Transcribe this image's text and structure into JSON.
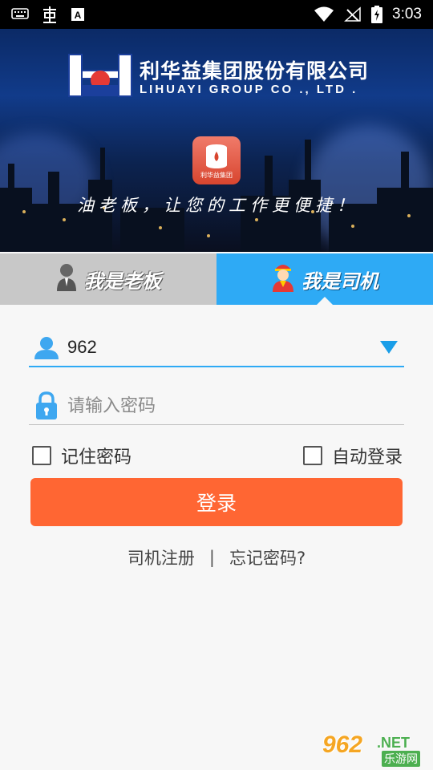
{
  "status_bar": {
    "time": "3:03",
    "icons": [
      "keyboard-icon",
      "bug-icon",
      "a-icon",
      "wifi-icon",
      "no-signal-icon",
      "battery-charging-icon"
    ]
  },
  "header": {
    "logo_cn": "利华益集团股份有限公司",
    "logo_en": "LIHUAYI GROUP CO ., LTD .",
    "app_icon_label": "利华益集团",
    "slogan": "油老板，让您的工作更便捷！"
  },
  "tabs": [
    {
      "label": "我是老板",
      "icon": "boss-avatar-icon",
      "selected": false
    },
    {
      "label": "我是司机",
      "icon": "driver-avatar-icon",
      "selected": true
    }
  ],
  "form": {
    "username_value": "962",
    "password_placeholder": "请输入密码",
    "remember_password_label": "记住密码",
    "auto_login_label": "自动登录",
    "login_button": "登录"
  },
  "links": {
    "register": "司机注册",
    "separator": "|",
    "forgot": "忘记密码?"
  },
  "watermark": {
    "num": "962",
    "net": ".NET",
    "site": "乐游网"
  },
  "colors": {
    "accent": "#2eaaf5",
    "button": "#ff6633",
    "tab_inactive": "#c8c8c8"
  }
}
